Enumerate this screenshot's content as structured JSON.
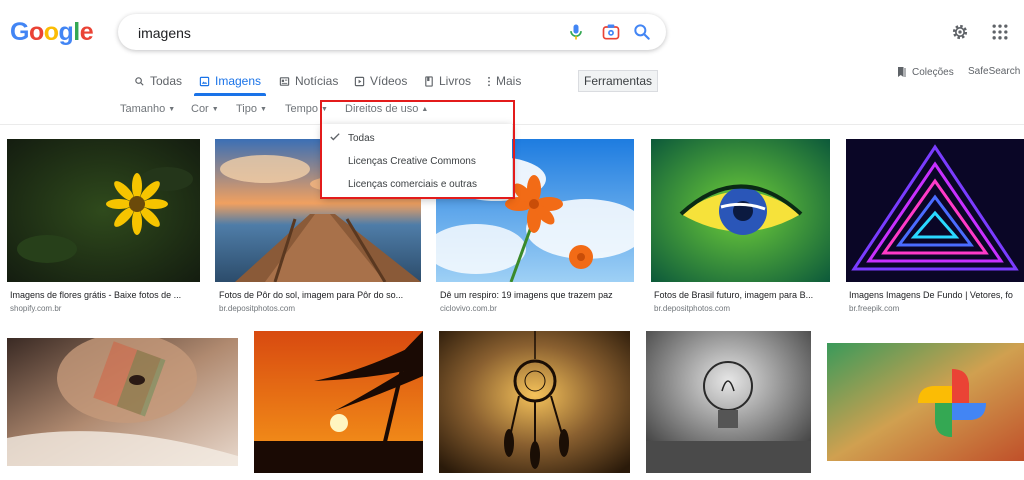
{
  "logo": {
    "letters": [
      "G",
      "o",
      "o",
      "g",
      "l",
      "e"
    ],
    "colors": [
      "#4285f4",
      "#ea4335",
      "#fbbc05",
      "#4285f4",
      "#34a853",
      "#ea4335"
    ]
  },
  "search": {
    "value": "imagens"
  },
  "tabs": [
    {
      "label": "Todas",
      "icon": "search-icon"
    },
    {
      "label": "Imagens",
      "icon": "image-icon",
      "active": true
    },
    {
      "label": "Notícias",
      "icon": "news-icon"
    },
    {
      "label": "Vídeos",
      "icon": "play-icon"
    },
    {
      "label": "Livros",
      "icon": "book-icon"
    },
    {
      "label": "Mais",
      "icon": "more-vert-icon"
    }
  ],
  "tools_label": "Ferramentas",
  "right": {
    "collections": "Coleções",
    "safesearch": "SafeSearch"
  },
  "filters": [
    "Tamanho",
    "Cor",
    "Tipo",
    "Tempo",
    "Direitos de uso"
  ],
  "usage_menu": {
    "selected": "Todas",
    "items": [
      "Todas",
      "Licenças Creative Commons",
      "Licenças comerciais e outras"
    ]
  },
  "results_row1": [
    {
      "caption": "Imagens de flores grátis - Baixe fotos de ...",
      "source": "shopify.com.br"
    },
    {
      "caption": "Fotos de Pôr do sol, imagem para Pôr do so...",
      "source": "br.depositphotos.com"
    },
    {
      "caption": "Dê um respiro: 19 imagens que trazem paz",
      "source": "ciclovivo.com.br"
    },
    {
      "caption": "Fotos de Brasil futuro, imagem para B...",
      "source": "br.depositphotos.com"
    },
    {
      "caption": "Imagens Imagens De Fundo | Vetores, fo",
      "source": "br.freepik.com"
    }
  ],
  "colors": {
    "accent": "#1a73e8",
    "highlight_box": "#e31b1b"
  }
}
